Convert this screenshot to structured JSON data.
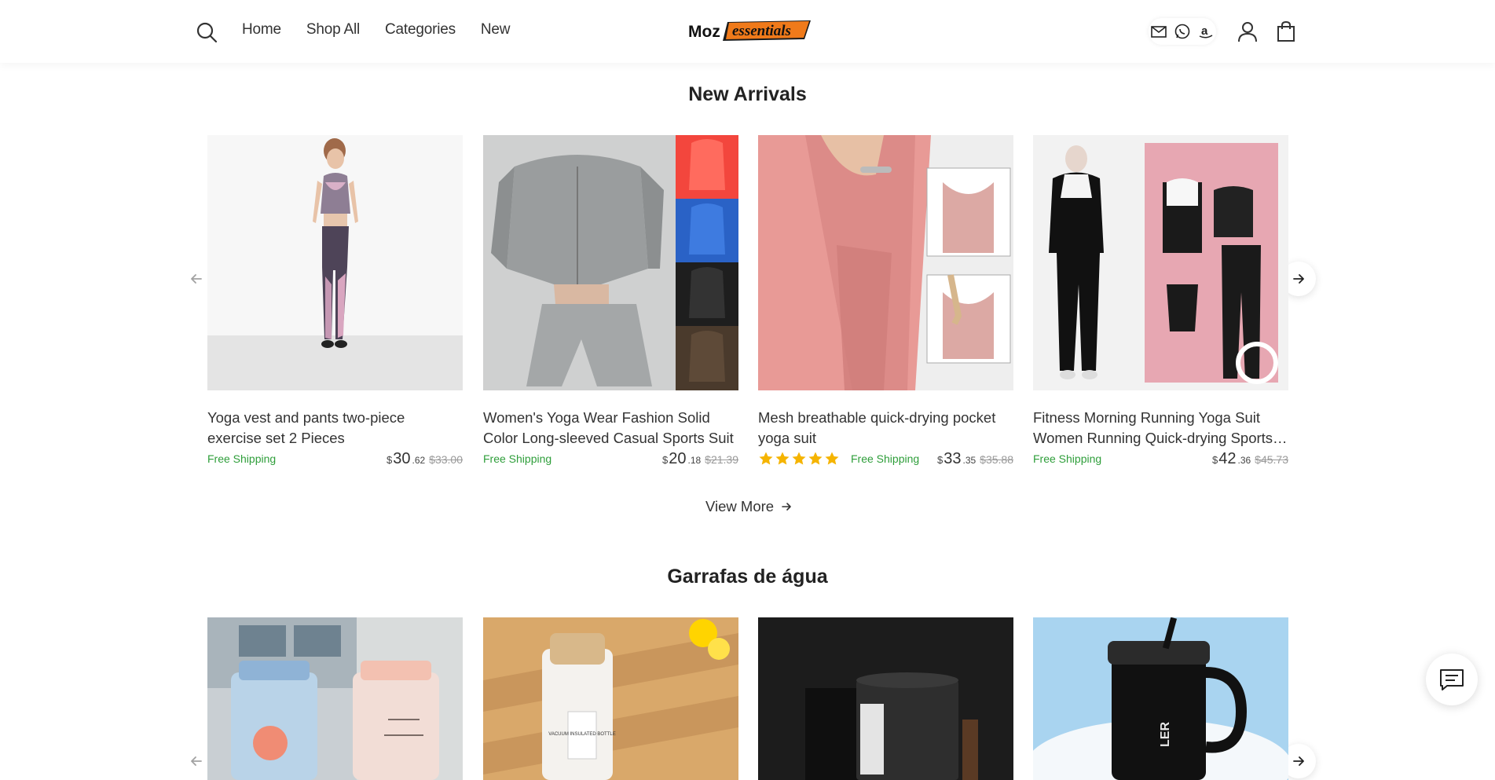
{
  "header": {
    "nav": [
      "Home",
      "Shop All",
      "Categories",
      "New"
    ],
    "logo_text_left": "Moz",
    "logo_text_right": "essentials"
  },
  "sections": [
    {
      "title": "New Arrivals",
      "view_more": "View More",
      "products": [
        {
          "title": "Yoga vest and pants two-piece exercise set 2 Pieces",
          "shipping": "Free Shipping",
          "currency": "$",
          "price_int": "30",
          "price_cents": ".62",
          "old_price": "$33.00"
        },
        {
          "title": "Women's Yoga Wear Fashion Solid Color Long-sleeved Casual Sports Suit",
          "shipping": "Free Shipping",
          "currency": "$",
          "price_int": "20",
          "price_cents": ".18",
          "old_price": "$21.39"
        },
        {
          "title": "Mesh breathable quick-drying pocket yoga suit",
          "shipping": "Free Shipping",
          "rating": 5,
          "currency": "$",
          "price_int": "33",
          "price_cents": ".35",
          "old_price": "$35.88"
        },
        {
          "title": "Fitness Morning Running Yoga Suit Women Running Quick-drying Sports Suit",
          "shipping": "Free Shipping",
          "currency": "$",
          "price_int": "42",
          "price_cents": ".36",
          "old_price": "$45.73"
        }
      ]
    },
    {
      "title": "Garrafas de água",
      "bottle_label": "VACUUM INSULATED BOTTLE",
      "cup_label": "LER"
    }
  ],
  "colors": {
    "accent_orange": "#f07a1a",
    "free_shipping_green": "#2e9e3a",
    "star_yellow": "#f5b400"
  },
  "icons": [
    "search-icon",
    "mail-icon",
    "whatsapp-icon",
    "amazon-icon",
    "user-icon",
    "bag-icon",
    "arrow-left-icon",
    "arrow-right-icon",
    "chat-icon",
    "star-icon"
  ]
}
